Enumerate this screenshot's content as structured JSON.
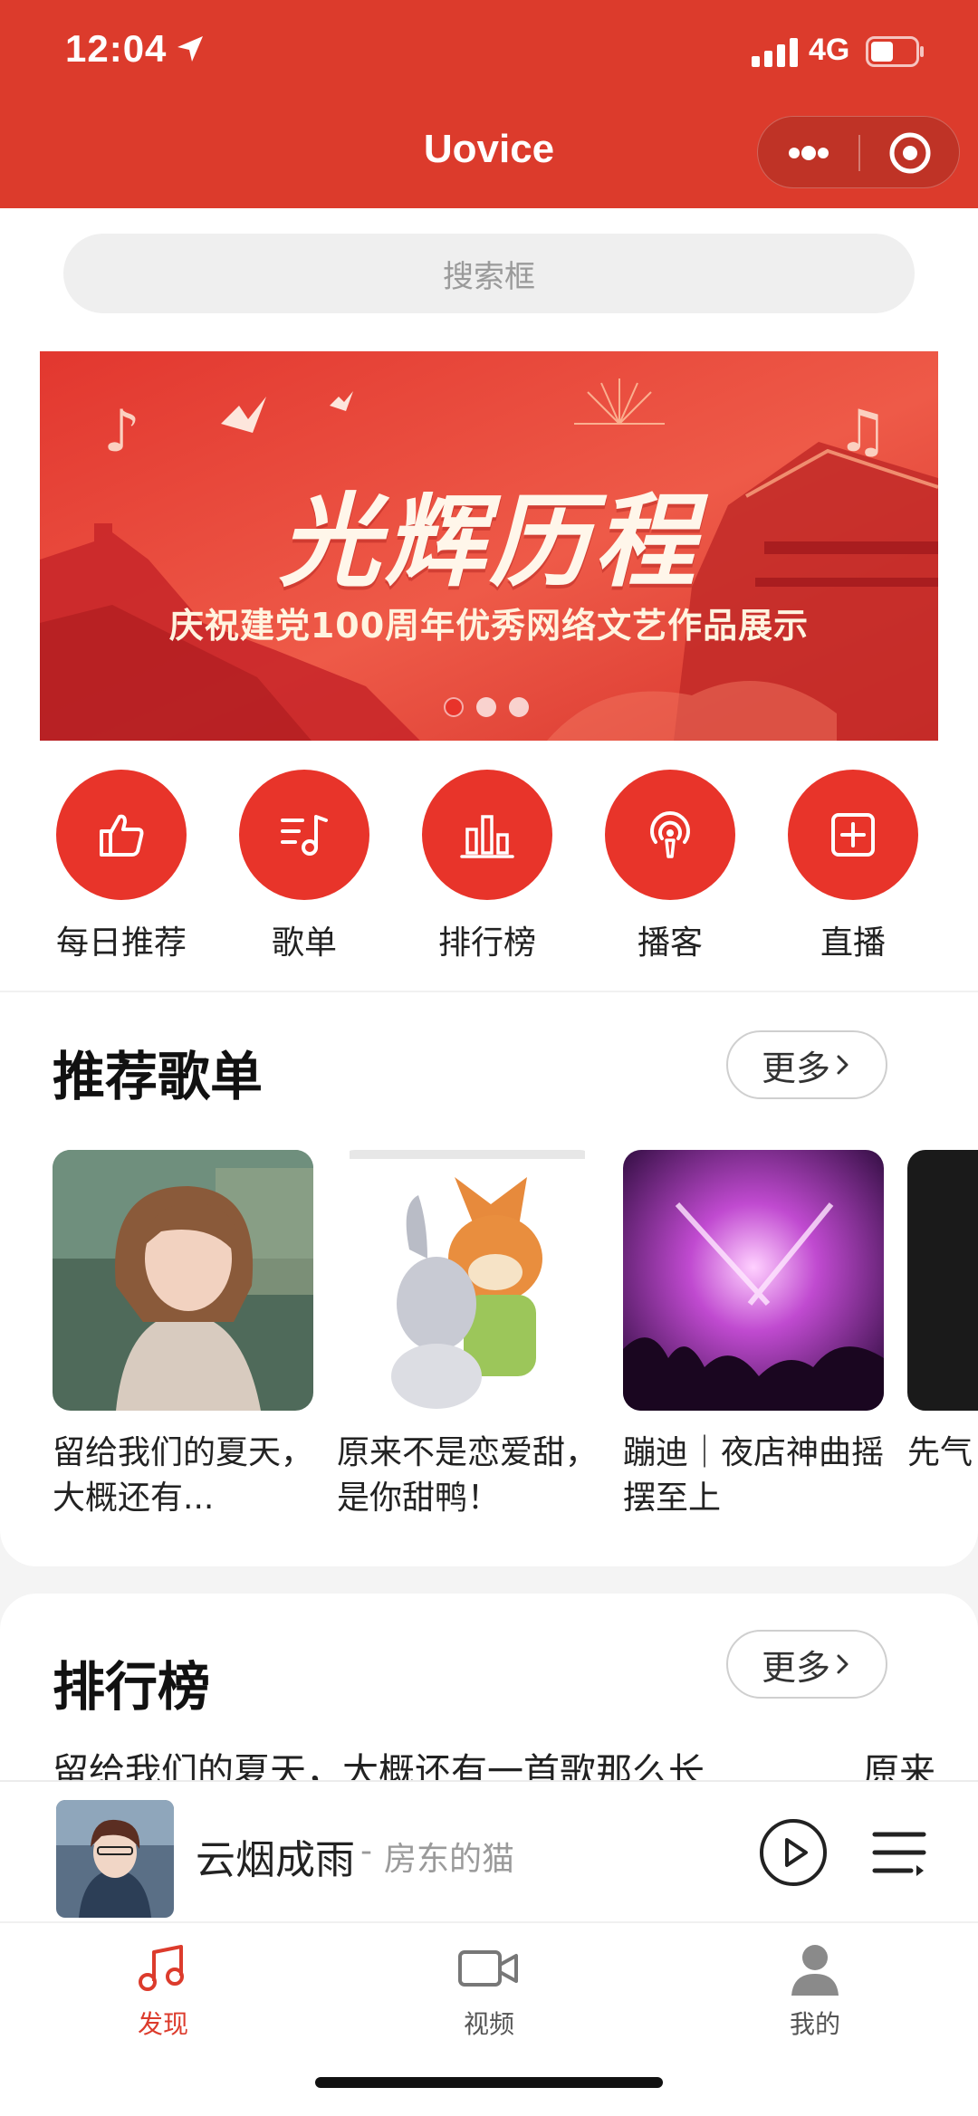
{
  "status_bar": {
    "time": "12:04",
    "network": "4G"
  },
  "header": {
    "title": "Uovice"
  },
  "search": {
    "placeholder": "搜索框"
  },
  "banner": {
    "headline": "光辉历程",
    "subtitle": "庆祝建党100周年优秀网络文艺作品展示",
    "page_indicator": {
      "current": 1,
      "total": 3
    }
  },
  "shortcuts": [
    {
      "label": "每日推荐",
      "icon": "thumbs-up-icon"
    },
    {
      "label": "歌单",
      "icon": "playlist-music-icon"
    },
    {
      "label": "排行榜",
      "icon": "bar-chart-icon"
    },
    {
      "label": "播客",
      "icon": "podcast-icon"
    },
    {
      "label": "直播",
      "icon": "plus-square-icon"
    }
  ],
  "recommended": {
    "title": "推荐歌单",
    "more_label": "更多",
    "playlists": [
      {
        "title": "留给我们的夏天，大概还有..."
      },
      {
        "title": "原来不是恋爱甜，是你甜鸭！"
      },
      {
        "title": "蹦迪｜夜店神曲摇摆至上"
      },
      {
        "title": "先气"
      }
    ]
  },
  "ranking": {
    "title": "排行榜",
    "more_label": "更多",
    "items": [
      "留给我们的夏天，大概还有一首歌那么长",
      "原来"
    ]
  },
  "player": {
    "song": "云烟成雨",
    "separator": "-",
    "artist": "房东的猫"
  },
  "tabbar": {
    "tabs": [
      {
        "label": "发现",
        "icon": "music-note-icon",
        "active": true
      },
      {
        "label": "视频",
        "icon": "video-camera-icon",
        "active": false
      },
      {
        "label": "我的",
        "icon": "user-icon",
        "active": false
      }
    ]
  },
  "colors": {
    "brand_red": "#dc3b2c",
    "shortcut_red": "#e8342a"
  }
}
